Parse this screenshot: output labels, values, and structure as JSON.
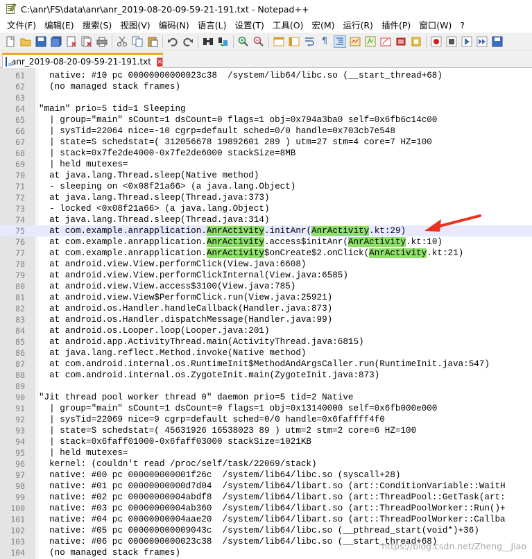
{
  "window": {
    "title": "C:\\anr\\FS\\data\\anr\\anr_2019-08-20-09-59-21-191.txt - Notepad++"
  },
  "menu": {
    "items": [
      "文件(F)",
      "编辑(E)",
      "搜索(S)",
      "视图(V)",
      "编码(N)",
      "语言(L)",
      "设置(T)",
      "工具(O)",
      "宏(M)",
      "运行(R)",
      "插件(P)",
      "窗口(W)",
      "?"
    ]
  },
  "toolbar": {
    "icons": [
      "new-file-icon",
      "open-file-icon",
      "save-icon",
      "save-all-icon",
      "close-icon",
      "close-all-icon",
      "print-icon",
      "cut-icon",
      "copy-icon",
      "paste-icon",
      "undo-icon",
      "redo-icon",
      "find-icon",
      "replace-icon",
      "zoom-in-icon",
      "zoom-out-icon",
      "sync-vertical-icon",
      "sync-horizontal-icon",
      "word-wrap-icon",
      "show-all-chars-icon",
      "indent-guide-icon",
      "doc-map-icon",
      "function-list-icon",
      "folder-as-workspace-icon",
      "monitoring-icon",
      "record-macro-icon",
      "stop-macro-icon",
      "play-macro-icon",
      "run-macro-multiple-icon",
      "save-macro-icon"
    ]
  },
  "tab": {
    "label": "anr_2019-08-20-09-59-21-191.txt",
    "close_glyph": "×"
  },
  "editor": {
    "highlight_term": "AnrActivity",
    "current_line": 75,
    "lines": [
      {
        "n": "61",
        "t": "  native: #10 pc 00000000000023c38  /system/lib64/libc.so (__start_thread+68)"
      },
      {
        "n": "62",
        "t": "  (no managed stack frames)"
      },
      {
        "n": "63",
        "t": ""
      },
      {
        "n": "64",
        "t": "\"main\" prio=5 tid=1 Sleeping"
      },
      {
        "n": "65",
        "t": "  | group=\"main\" sCount=1 dsCount=0 flags=1 obj=0x794a3ba0 self=0x6fb6c14c00"
      },
      {
        "n": "66",
        "t": "  | sysTid=22064 nice=-10 cgrp=default sched=0/0 handle=0x703cb7e548"
      },
      {
        "n": "67",
        "t": "  | state=S schedstat=( 312056678 19892601 289 ) utm=27 stm=4 core=7 HZ=100"
      },
      {
        "n": "68",
        "t": "  | stack=0x7fe2de4000-0x7fe2de6000 stackSize=8MB"
      },
      {
        "n": "69",
        "t": "  | held mutexes="
      },
      {
        "n": "70",
        "t": "  at java.lang.Thread.sleep(Native method)"
      },
      {
        "n": "71",
        "t": "  - sleeping on <0x08f21a66> (a java.lang.Object)"
      },
      {
        "n": "72",
        "t": "  at java.lang.Thread.sleep(Thread.java:373)"
      },
      {
        "n": "73",
        "t": "  - locked <0x08f21a66> (a java.lang.Object)"
      },
      {
        "n": "74",
        "t": "  at java.lang.Thread.sleep(Thread.java:314)"
      },
      {
        "n": "75",
        "t": "  at com.example.anrapplication.AnrActivity.initAnr(AnrActivity.kt:29)"
      },
      {
        "n": "76",
        "t": "  at com.example.anrapplication.AnrActivity.access$initAnr(AnrActivity.kt:10)"
      },
      {
        "n": "77",
        "t": "  at com.example.anrapplication.AnrActivity$onCreate$2.onClick(AnrActivity.kt:21)"
      },
      {
        "n": "78",
        "t": "  at android.view.View.performClick(View.java:6608)"
      },
      {
        "n": "79",
        "t": "  at android.view.View.performClickInternal(View.java:6585)"
      },
      {
        "n": "80",
        "t": "  at android.view.View.access$3100(View.java:785)"
      },
      {
        "n": "81",
        "t": "  at android.view.View$PerformClick.run(View.java:25921)"
      },
      {
        "n": "82",
        "t": "  at android.os.Handler.handleCallback(Handler.java:873)"
      },
      {
        "n": "83",
        "t": "  at android.os.Handler.dispatchMessage(Handler.java:99)"
      },
      {
        "n": "84",
        "t": "  at android.os.Looper.loop(Looper.java:201)"
      },
      {
        "n": "85",
        "t": "  at android.app.ActivityThread.main(ActivityThread.java:6815)"
      },
      {
        "n": "86",
        "t": "  at java.lang.reflect.Method.invoke(Native method)"
      },
      {
        "n": "87",
        "t": "  at com.android.internal.os.RuntimeInit$MethodAndArgsCaller.run(RuntimeInit.java:547)"
      },
      {
        "n": "88",
        "t": "  at com.android.internal.os.ZygoteInit.main(ZygoteInit.java:873)"
      },
      {
        "n": "89",
        "t": ""
      },
      {
        "n": "90",
        "t": "\"Jit thread pool worker thread 0\" daemon prio=5 tid=2 Native"
      },
      {
        "n": "91",
        "t": "  | group=\"main\" sCount=1 dsCount=0 flags=1 obj=0x13140000 self=0x6fb000e000"
      },
      {
        "n": "92",
        "t": "  | sysTid=22069 nice=9 cgrp=default sched=0/0 handle=0x6faffff4f0"
      },
      {
        "n": "93",
        "t": "  | state=S schedstat=( 45631926 16538023 89 ) utm=2 stm=2 core=6 HZ=100"
      },
      {
        "n": "94",
        "t": "  | stack=0x6faff01000-0x6faff03000 stackSize=1021KB"
      },
      {
        "n": "95",
        "t": "  | held mutexes="
      },
      {
        "n": "96",
        "t": "  kernel: (couldn't read /proc/self/task/22069/stack)"
      },
      {
        "n": "97",
        "t": "  native: #00 pc 000000000001f26c  /system/lib64/libc.so (syscall+28)"
      },
      {
        "n": "98",
        "t": "  native: #01 pc 00000000000d7d04  /system/lib64/libart.so (art::ConditionVariable::WaitH"
      },
      {
        "n": "99",
        "t": "  native: #02 pc 00000000004abdf8  /system/lib64/libart.so (art::ThreadPool::GetTask(art:"
      },
      {
        "n": "100",
        "t": "  native: #03 pc 00000000004ab360  /system/lib64/libart.so (art::ThreadPoolWorker::Run()+"
      },
      {
        "n": "101",
        "t": "  native: #04 pc 00000000004aae20  /system/lib64/libart.so (art::ThreadPoolWorker::Callba"
      },
      {
        "n": "102",
        "t": "  native: #05 pc 000000000009043c  /system/lib64/libc.so (__pthread_start(void*)+36)"
      },
      {
        "n": "103",
        "t": "  native: #06 pc 0000000000023c38  /system/lib64/libc.so (__start_thread+68)"
      },
      {
        "n": "104",
        "t": "  (no managed stack frames)"
      }
    ]
  },
  "annotation": {
    "arrow_color": "#e8321e"
  },
  "watermark": {
    "text": "https://blog.csdn.net/Zheng__Jiao"
  }
}
